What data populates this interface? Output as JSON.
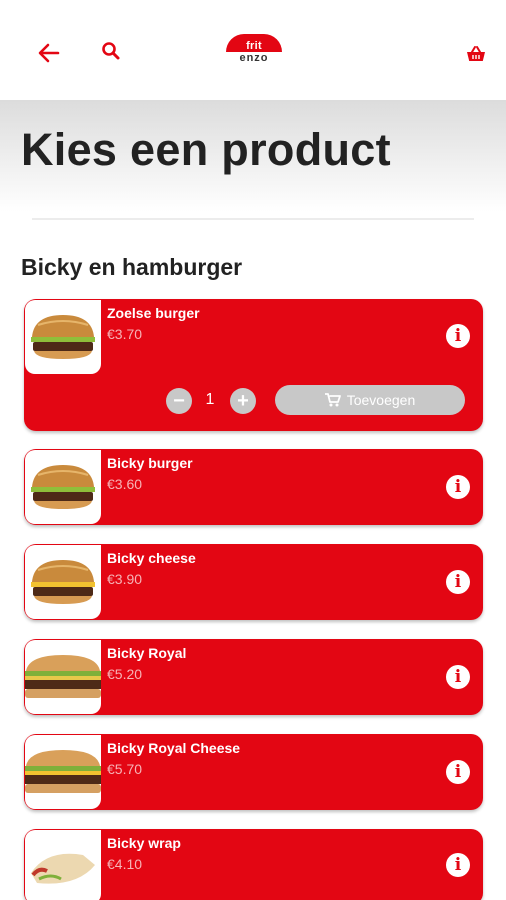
{
  "header": {
    "logo_top": "frit",
    "logo_bottom": "enzo"
  },
  "page": {
    "title": "Kies een product",
    "section": "Bicky en hamburger"
  },
  "products": [
    {
      "name": "Zoelse burger",
      "price": "€3.70",
      "image": "burger-image"
    },
    {
      "name": "Bicky burger",
      "price": "€3.60",
      "image": "burger-image"
    },
    {
      "name": "Bicky cheese",
      "price": "€3.90",
      "image": "burger-image"
    },
    {
      "name": "Bicky Royal",
      "price": "€5.20",
      "image": "long-burger-image"
    },
    {
      "name": "Bicky Royal Cheese",
      "price": "€5.70",
      "image": "long-burger-image"
    },
    {
      "name": "Bicky wrap",
      "price": "€4.10",
      "image": "wrap-image"
    }
  ],
  "expanded": {
    "quantity": "1",
    "add_label": "Toevoegen"
  },
  "colors": {
    "accent": "#e30613",
    "price": "#f6b3b6",
    "disabled": "#c8c8c8"
  }
}
